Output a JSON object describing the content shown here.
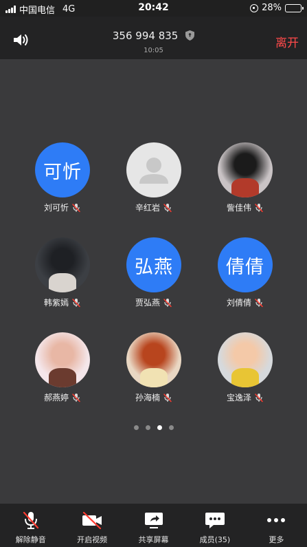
{
  "status_bar": {
    "carrier": "中国电信",
    "network": "4G",
    "time": "20:42",
    "battery": "28%",
    "battery_level": 0.28
  },
  "header": {
    "meeting_id": "356 994 835",
    "duration": "10:05",
    "leave_label": "离开"
  },
  "participants": [
    {
      "name": "刘可忻",
      "avatar_text": "可忻",
      "avatar_type": "text"
    },
    {
      "name": "辛红岩",
      "avatar_type": "default"
    },
    {
      "name": "訾佳伟",
      "avatar_type": "photo",
      "photo_colors": [
        "#c9c3c5",
        "#1b1b1b",
        "#b23a2a"
      ]
    },
    {
      "name": "韩紫嫣",
      "avatar_type": "photo",
      "photo_colors": [
        "#3c3f44",
        "#1e2024",
        "#d9d4cf"
      ]
    },
    {
      "name": "贾弘燕",
      "avatar_text": "弘燕",
      "avatar_type": "text"
    },
    {
      "name": "刘倩倩",
      "avatar_text": "倩倩",
      "avatar_type": "text"
    },
    {
      "name": "郝燕婷",
      "avatar_type": "photo",
      "photo_colors": [
        "#f4e6ea",
        "#e8b7a5",
        "#6b3b2f"
      ]
    },
    {
      "name": "孙海楠",
      "avatar_type": "photo",
      "photo_colors": [
        "#e9d7c3",
        "#b8451e",
        "#f1e2b3"
      ]
    },
    {
      "name": "宝逸泽",
      "avatar_type": "photo",
      "photo_colors": [
        "#d6d9dc",
        "#f4c9a8",
        "#e8c534"
      ]
    }
  ],
  "pager": {
    "pages": 4,
    "active_page": 3
  },
  "toolbar": {
    "unmute": "解除静音",
    "video": "开启视频",
    "share": "共享屏幕",
    "members": "成员(35)",
    "more": "更多"
  }
}
